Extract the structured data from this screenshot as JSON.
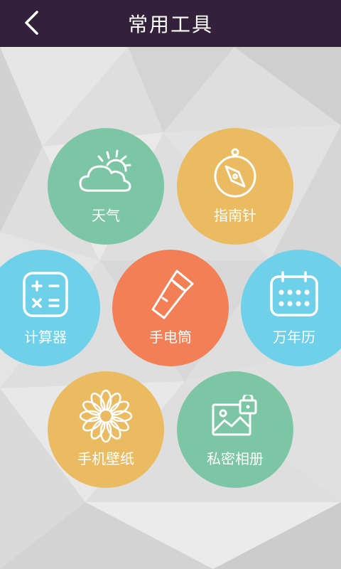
{
  "header": {
    "title": "常用工具",
    "back_icon": "chevron-left-icon",
    "background": "#33203a"
  },
  "tools": [
    {
      "id": "weather",
      "label": "天气",
      "icon": "weather-cloud-sun-icon",
      "color": "#7dc6a5"
    },
    {
      "id": "compass",
      "label": "指南针",
      "icon": "compass-icon",
      "color": "#ebbb62"
    },
    {
      "id": "calculator",
      "label": "计算器",
      "icon": "calculator-icon",
      "color": "#6fd0ea"
    },
    {
      "id": "flashlight",
      "label": "手电筒",
      "icon": "flashlight-icon",
      "color": "#f27f55"
    },
    {
      "id": "calendar",
      "label": "万年历",
      "icon": "calendar-icon",
      "color": "#6fd0ea"
    },
    {
      "id": "wallpaper",
      "label": "手机壁纸",
      "icon": "flower-icon",
      "color": "#ebbb62"
    },
    {
      "id": "album",
      "label": "私密相册",
      "icon": "private-photo-icon",
      "color": "#7dc6a5"
    }
  ]
}
